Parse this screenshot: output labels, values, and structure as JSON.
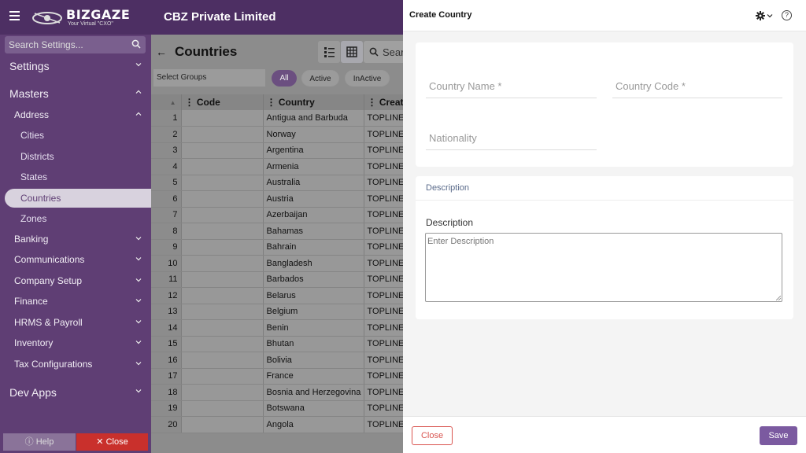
{
  "app": {
    "logo_text": "BIZGAZE",
    "logo_tagline": "Your Virtual \"CXO\"",
    "company_name": "CBZ Private Limited"
  },
  "sidebar": {
    "search_placeholder": "Search Settings...",
    "items": [
      {
        "label": "Settings",
        "level": 0,
        "chevron": "down"
      },
      {
        "label": "Masters",
        "level": 0,
        "chevron": "up"
      },
      {
        "label": "Address",
        "level": 1,
        "chevron": "up"
      },
      {
        "label": "Cities",
        "level": 2
      },
      {
        "label": "Districts",
        "level": 2
      },
      {
        "label": "States",
        "level": 2
      },
      {
        "label": "Countries",
        "level": 2,
        "active": true
      },
      {
        "label": "Zones",
        "level": 2
      },
      {
        "label": "Banking",
        "level": 1,
        "chevron": "down"
      },
      {
        "label": "Communications",
        "level": 1,
        "chevron": "down"
      },
      {
        "label": "Company Setup",
        "level": 1,
        "chevron": "down"
      },
      {
        "label": "Finance",
        "level": 1,
        "chevron": "down"
      },
      {
        "label": "HRMS & Payroll",
        "level": 1,
        "chevron": "down"
      },
      {
        "label": "Inventory",
        "level": 1,
        "chevron": "down"
      },
      {
        "label": "Tax Configurations",
        "level": 1,
        "chevron": "down"
      },
      {
        "label": "Dev Apps",
        "level": 0,
        "chevron": "down"
      }
    ],
    "help_label": "Help",
    "close_label": "Close"
  },
  "main": {
    "title": "Countries",
    "search_text": "Sear",
    "select_groups": "Select Groups",
    "filters": [
      "All",
      "Active",
      "InActive"
    ],
    "columns": [
      "Code",
      "Country",
      "Create"
    ],
    "rows": [
      {
        "num": "1",
        "code": "",
        "country": "Antigua and Barbuda",
        "created": "TOPLINE"
      },
      {
        "num": "2",
        "code": "",
        "country": "Norway",
        "created": "TOPLINE"
      },
      {
        "num": "3",
        "code": "",
        "country": "Argentina",
        "created": "TOPLINE"
      },
      {
        "num": "4",
        "code": "",
        "country": "Armenia",
        "created": "TOPLINE"
      },
      {
        "num": "5",
        "code": "",
        "country": "Australia",
        "created": "TOPLINE"
      },
      {
        "num": "6",
        "code": "",
        "country": "Austria",
        "created": "TOPLINE"
      },
      {
        "num": "7",
        "code": "",
        "country": "Azerbaijan",
        "created": "TOPLINE"
      },
      {
        "num": "8",
        "code": "",
        "country": "Bahamas",
        "created": "TOPLINE"
      },
      {
        "num": "9",
        "code": "",
        "country": "Bahrain",
        "created": "TOPLINE"
      },
      {
        "num": "10",
        "code": "",
        "country": "Bangladesh",
        "created": "TOPLINE"
      },
      {
        "num": "11",
        "code": "",
        "country": "Barbados",
        "created": "TOPLINE"
      },
      {
        "num": "12",
        "code": "",
        "country": "Belarus",
        "created": "TOPLINE"
      },
      {
        "num": "13",
        "code": "",
        "country": "Belgium",
        "created": "TOPLINE"
      },
      {
        "num": "14",
        "code": "",
        "country": "Benin",
        "created": "TOPLINE"
      },
      {
        "num": "15",
        "code": "",
        "country": "Bhutan",
        "created": "TOPLINE"
      },
      {
        "num": "16",
        "code": "",
        "country": "Bolivia",
        "created": "TOPLINE"
      },
      {
        "num": "17",
        "code": "",
        "country": "France",
        "created": "TOPLINE"
      },
      {
        "num": "18",
        "code": "",
        "country": "Bosnia and Herzegovina",
        "created": "TOPLINE"
      },
      {
        "num": "19",
        "code": "",
        "country": "Botswana",
        "created": "TOPLINE"
      },
      {
        "num": "20",
        "code": "",
        "country": "Angola",
        "created": "TOPLINE"
      }
    ]
  },
  "panel": {
    "title": "Create Country",
    "fields": {
      "country_name": "Country Name *",
      "country_code": "Country Code *",
      "nationality": "Nationality"
    },
    "description_section": "Description",
    "description_label": "Description",
    "description_placeholder": "Enter Description",
    "close_label": "Close",
    "save_label": "Save"
  },
  "colors": {
    "topbar": "#4d2f63",
    "sidebar": "#5f3e74",
    "accent": "#7b5aa0",
    "danger": "#d9534f"
  }
}
